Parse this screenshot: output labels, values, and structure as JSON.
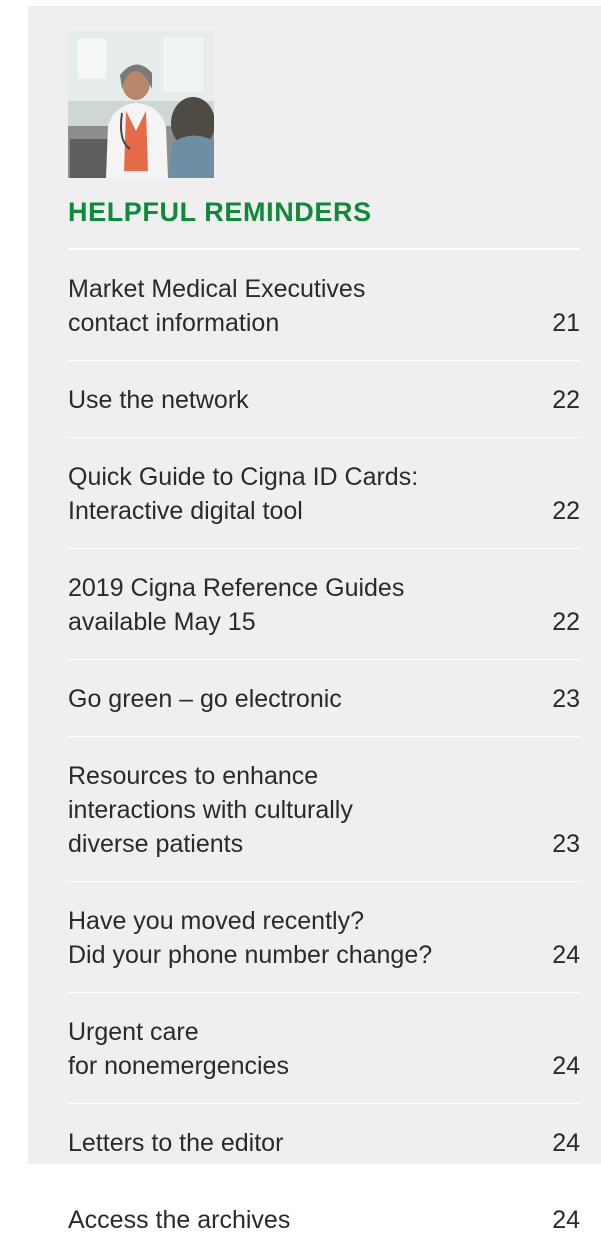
{
  "section": {
    "heading": "HELPFUL REMINDERS",
    "photo_alt": "photo-doctor",
    "accent_color": "#0f8a3b",
    "panel_color": "#efeff0"
  },
  "toc": [
    {
      "title": "Market Medical Executives\ncontact information",
      "page": "21"
    },
    {
      "title": "Use the network",
      "page": "22"
    },
    {
      "title": "Quick Guide to Cigna ID Cards:\nInteractive digital tool",
      "page": "22"
    },
    {
      "title": "2019 Cigna Reference Guides\navailable May 15",
      "page": "22"
    },
    {
      "title": "Go green – go electronic",
      "page": "23"
    },
    {
      "title": "Resources to enhance\ninteractions with culturally\ndiverse patients",
      "page": "23"
    },
    {
      "title": "Have you moved recently?\nDid your phone number change?",
      "page": "24"
    },
    {
      "title": "Urgent care\nfor nonemergencies",
      "page": "24"
    },
    {
      "title": "Letters to the editor",
      "page": "24"
    },
    {
      "title": "Access the archives",
      "page": "24"
    }
  ]
}
